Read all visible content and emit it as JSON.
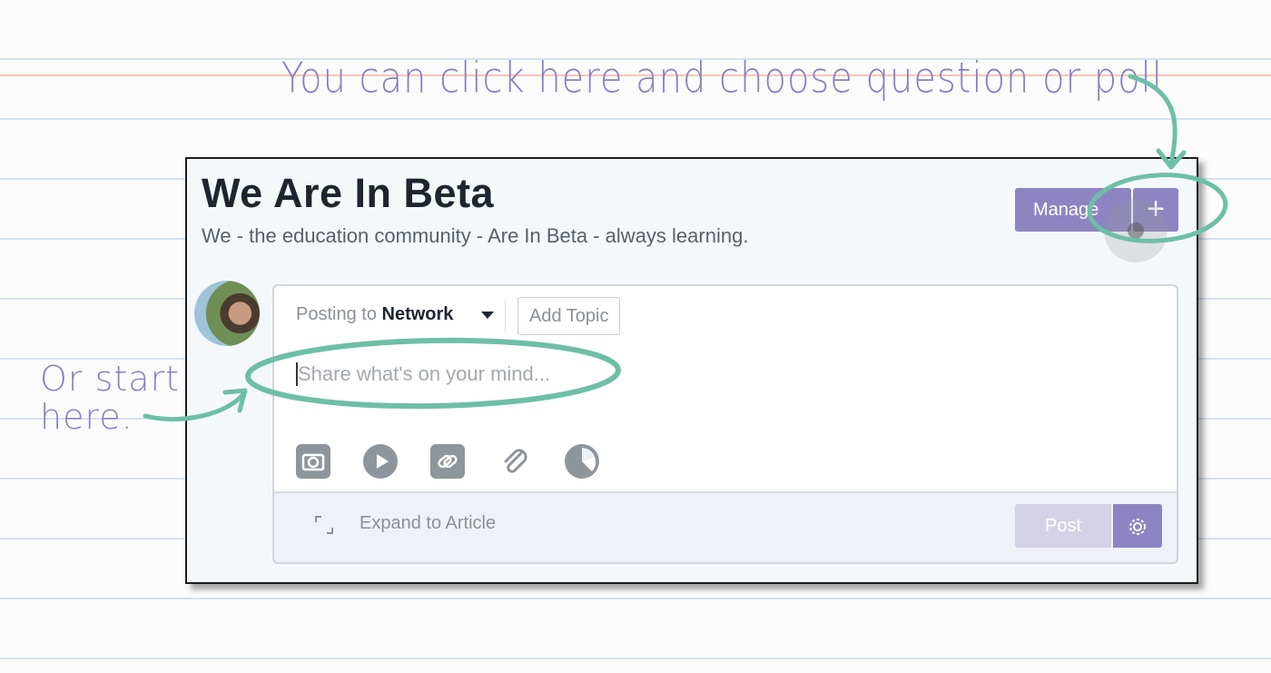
{
  "annotations": {
    "top_note": "You can click here and choose question or poll",
    "left_note": "Or start here."
  },
  "group": {
    "title": "We Are In Beta",
    "subtitle": "We - the education community - Are In Beta - always learning.",
    "manage_label": "Manage",
    "plus_label": "+"
  },
  "composer": {
    "posting_prefix": "Posting to",
    "posting_target": "Network",
    "add_topic": "Add Topic",
    "placeholder": "Share what's on your mind...",
    "expand_label": "Expand to Article",
    "post_label": "Post"
  },
  "icons": [
    "camera-icon",
    "play-icon",
    "link-icon",
    "paperclip-icon",
    "pie-chart-icon",
    "expand-icon",
    "gear-icon"
  ],
  "colors": {
    "accent": "#8d84c1",
    "annotation_teal": "#6dbfa7",
    "annotation_text": "#8a7fc0"
  }
}
